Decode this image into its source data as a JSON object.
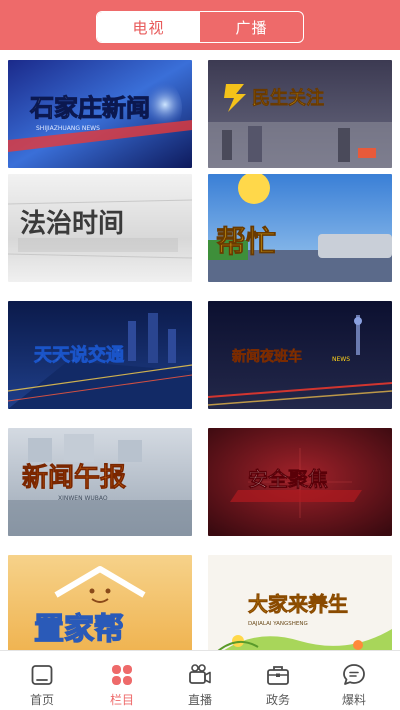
{
  "header": {
    "tabs": [
      {
        "label": "电视",
        "active": true
      },
      {
        "label": "广播",
        "active": false
      }
    ],
    "bg_color": "#ee6a6a"
  },
  "programs": [
    {
      "title": "石家庄新闻",
      "subtitle": "SHIJIAZHUANG NEWS"
    },
    {
      "title": "民生关注"
    },
    {
      "title": "法治时间"
    },
    {
      "title": "帮忙"
    },
    {
      "title": "天天说交通"
    },
    {
      "title": "新闻夜班车",
      "subtitle": "NEWS"
    },
    {
      "title": "新闻午报",
      "subtitle": "XINWEN WUBAO"
    },
    {
      "title": "安全聚焦"
    },
    {
      "title": "置家帮"
    },
    {
      "title": "大家来养生",
      "subtitle": "DAJIALAI YANGSHENG"
    }
  ],
  "tabbar": {
    "items": [
      {
        "label": "首页",
        "icon": "home-icon",
        "active": false
      },
      {
        "label": "栏目",
        "icon": "grid-icon",
        "active": true
      },
      {
        "label": "直播",
        "icon": "video-camera-icon",
        "active": false
      },
      {
        "label": "政务",
        "icon": "briefcase-icon",
        "active": false
      },
      {
        "label": "爆料",
        "icon": "chat-bubble-icon",
        "active": false
      }
    ],
    "accent_color": "#ee6a6a"
  }
}
